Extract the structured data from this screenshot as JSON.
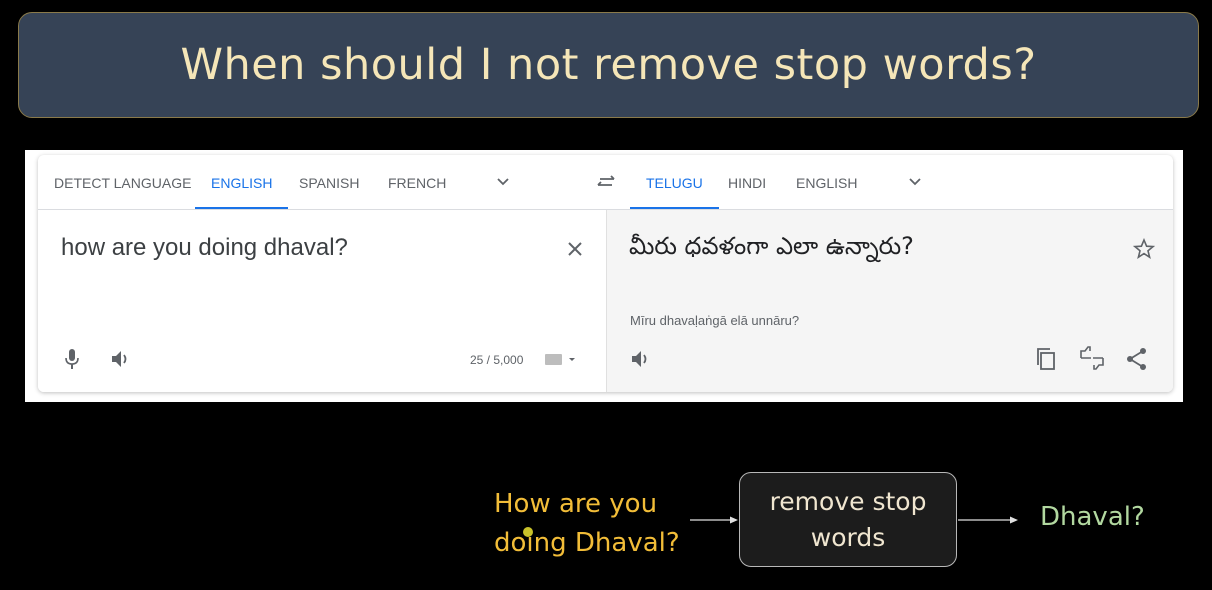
{
  "slide": {
    "title": "When should I not remove stop words?"
  },
  "translate": {
    "source_tabs": [
      {
        "label": "DETECT LANGUAGE",
        "active": false
      },
      {
        "label": "ENGLISH",
        "active": true
      },
      {
        "label": "SPANISH",
        "active": false
      },
      {
        "label": "FRENCH",
        "active": false
      }
    ],
    "target_tabs": [
      {
        "label": "TELUGU",
        "active": true
      },
      {
        "label": "HINDI",
        "active": false
      },
      {
        "label": "ENGLISH",
        "active": false
      }
    ],
    "source_text": "how are you doing dhaval?",
    "char_count": "25 / 5,000",
    "target_text": "మీరు ధవళంగా ఎలా ఉన్నారు?",
    "romanization": "Mīru dhavaḷaṅgā elā unnāru?",
    "accent_color": "#1a73e8"
  },
  "flow": {
    "input_text_line1": "How are you",
    "input_text_line2": "doing Dhaval?",
    "process_label_line1": "remove stop",
    "process_label_line2": "words",
    "output_text": "Dhaval?",
    "input_color": "#f2bd38",
    "output_color": "#b2d8a0"
  }
}
